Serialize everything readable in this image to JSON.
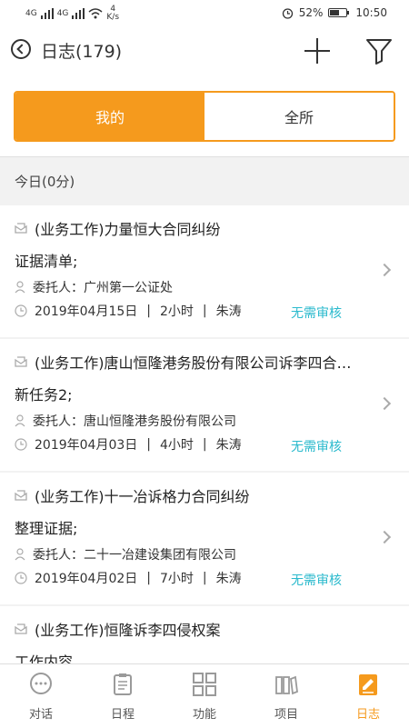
{
  "statusbar": {
    "signal1": "4G",
    "signal2": "4G",
    "speed_value": "4",
    "speed_unit": "K/s",
    "battery": "52%",
    "time": "10:50"
  },
  "header": {
    "title": "日志(179)"
  },
  "segment": {
    "mine": "我的",
    "all": "全所"
  },
  "section": {
    "today": "今日(0分)"
  },
  "items": [
    {
      "title": "(业务工作)力量恒大合同纠纷",
      "content": "证据清单;",
      "client": "委托人：广州第一公证处",
      "date": "2019年04月15日",
      "duration": "2小时",
      "person": "朱涛",
      "status": "无需审核"
    },
    {
      "title": "(业务工作)唐山恒隆港务股份有限公司诉李四合…",
      "content": "新任务2;",
      "client": "委托人：唐山恒隆港务股份有限公司",
      "date": "2019年04月03日",
      "duration": "4小时",
      "person": "朱涛",
      "status": "无需审核"
    },
    {
      "title": "(业务工作)十一冶诉格力合同纠纷",
      "content": "整理证据;",
      "client": "委托人：二十一冶建设集团有限公司",
      "date": "2019年04月02日",
      "duration": "7小时",
      "person": "朱涛",
      "status": "无需审核"
    },
    {
      "title": "(业务工作)恒隆诉李四侵权案",
      "content": "工作内容",
      "client": "",
      "date": "",
      "duration": "",
      "person": "",
      "status": ""
    }
  ],
  "separator": "|",
  "tabs": [
    {
      "label": "对话"
    },
    {
      "label": "日程"
    },
    {
      "label": "功能"
    },
    {
      "label": "项目"
    },
    {
      "label": "日志"
    }
  ],
  "colors": {
    "accent": "#f59a1d",
    "status": "#2bbacd"
  }
}
